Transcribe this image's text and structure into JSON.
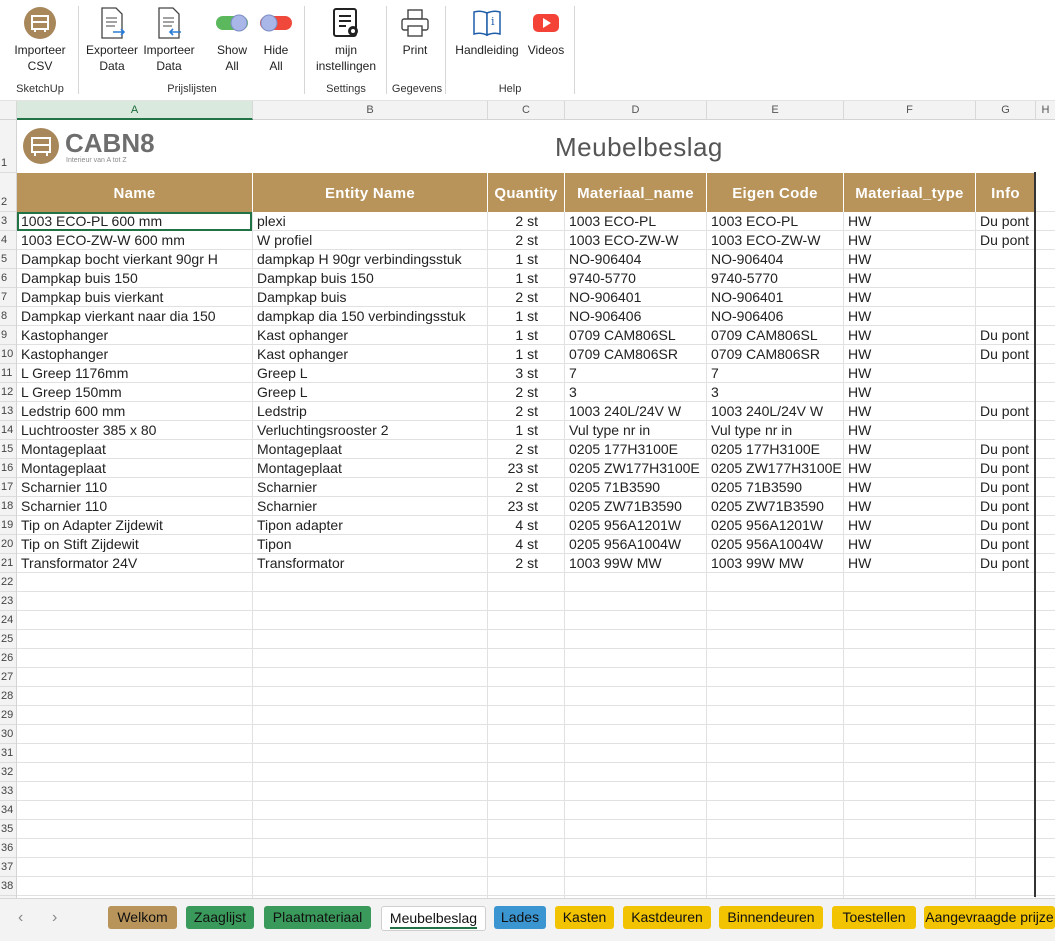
{
  "ribbon": {
    "buttons": [
      {
        "label": "Importeer\nCSV",
        "icon": "sketchup-logo-icon"
      },
      {
        "label": "Exporteer\nData",
        "icon": "export-document-icon"
      },
      {
        "label": "Importeer\nData",
        "icon": "import-document-icon"
      },
      {
        "label": "Show\nAll",
        "icon": "toggle-on-icon"
      },
      {
        "label": "Hide\nAll",
        "icon": "toggle-off-icon"
      },
      {
        "label": "mijn\ninstellingen",
        "icon": "settings-list-icon"
      },
      {
        "label": "Print",
        "icon": "printer-icon"
      },
      {
        "label": "Handleiding",
        "icon": "manual-book-icon"
      },
      {
        "label": "Videos",
        "icon": "youtube-play-icon"
      }
    ],
    "groups": [
      "SketchUp",
      "Prijslijsten",
      "Settings",
      "Gegevens",
      "Help"
    ]
  },
  "columns": [
    "A",
    "B",
    "C",
    "D",
    "E",
    "F",
    "G",
    "H"
  ],
  "logo": {
    "brand": "CABN8",
    "tagline": "Interieur van A tot Z"
  },
  "sheet_title": "Meubelbeslag",
  "table": {
    "headers": [
      "Name",
      "Entity Name",
      "Quantity",
      "Materiaal_name",
      "Eigen Code",
      "Materiaal_type",
      "Info"
    ],
    "rows": [
      [
        "1003 ECO-PL 600 mm",
        "plexi",
        "2 st",
        "1003 ECO-PL",
        "1003 ECO-PL",
        "HW",
        "Du pont"
      ],
      [
        "1003 ECO-ZW-W 600 mm",
        "W profiel",
        "2 st",
        "1003 ECO-ZW-W",
        "1003 ECO-ZW-W",
        "HW",
        "Du pont"
      ],
      [
        "Dampkap bocht vierkant 90gr H",
        "dampkap H 90gr verbindingsstuk",
        "1 st",
        "NO-906404",
        "NO-906404",
        "HW",
        ""
      ],
      [
        "Dampkap buis 150",
        "Dampkap buis 150",
        "1 st",
        "9740-5770",
        "9740-5770",
        "HW",
        ""
      ],
      [
        "Dampkap buis vierkant",
        "Dampkap buis",
        "2 st",
        "NO-906401",
        "NO-906401",
        "HW",
        ""
      ],
      [
        "Dampkap vierkant naar dia 150",
        "dampkap dia 150 verbindingsstuk",
        "1 st",
        "NO-906406",
        "NO-906406",
        "HW",
        ""
      ],
      [
        "Kastophanger",
        "Kast ophanger",
        "1 st",
        "0709 CAM806SL",
        "0709 CAM806SL",
        "HW",
        "Du pont"
      ],
      [
        "Kastophanger",
        "Kast ophanger",
        "1 st",
        "0709 CAM806SR",
        "0709 CAM806SR",
        "HW",
        "Du pont"
      ],
      [
        "L Greep 1176mm",
        "Greep L",
        "3 st",
        "7",
        "7",
        "HW",
        ""
      ],
      [
        "L Greep 150mm",
        "Greep L",
        "2 st",
        "3",
        "3",
        "HW",
        ""
      ],
      [
        "Ledstrip 600 mm",
        "Ledstrip",
        "2 st",
        "1003 240L/24V W",
        "1003 240L/24V W",
        "HW",
        "Du pont"
      ],
      [
        "Luchtrooster 385 x 80",
        "Verluchtingsrooster 2",
        "1 st",
        "Vul type nr in",
        "Vul type nr in",
        "HW",
        ""
      ],
      [
        "Montageplaat",
        "Montageplaat",
        "2 st",
        "0205 177H3100E",
        "0205 177H3100E",
        "HW",
        "Du pont"
      ],
      [
        "Montageplaat",
        "Montageplaat",
        "23 st",
        "0205 ZW177H3100E",
        "0205 ZW177H3100E",
        "HW",
        "Du pont"
      ],
      [
        "Scharnier 110",
        "Scharnier",
        "2 st",
        "0205 71B3590",
        "0205 71B3590",
        "HW",
        "Du pont"
      ],
      [
        "Scharnier 110",
        "Scharnier",
        "23 st",
        "0205 ZW71B3590",
        "0205 ZW71B3590",
        "HW",
        "Du pont"
      ],
      [
        "Tip on Adapter Zijdewit",
        "Tipon adapter",
        "4 st",
        "0205 956A1201W",
        "0205 956A1201W",
        "HW",
        "Du pont"
      ],
      [
        "Tip on Stift Zijdewit",
        "Tipon",
        "4 st",
        "0205 956A1004W",
        "0205 956A1004W",
        "HW",
        "Du pont"
      ],
      [
        "Transformator 24V",
        "Transformator",
        "2 st",
        "1003 99W MW",
        "1003 99W MW",
        "HW",
        "Du pont"
      ]
    ]
  },
  "row_numbers": [
    "1",
    "2",
    "3",
    "4",
    "5",
    "6",
    "7",
    "8",
    "9",
    "10",
    "11",
    "12",
    "13",
    "14",
    "15",
    "16",
    "17",
    "18",
    "19",
    "20",
    "21",
    "22",
    "23",
    "24",
    "25",
    "26",
    "27",
    "28",
    "29",
    "30",
    "31",
    "32",
    "33",
    "34",
    "35",
    "36",
    "37",
    "38"
  ],
  "tabs": [
    {
      "label": "Welkom",
      "color": "#b8935a"
    },
    {
      "label": "Zaaglijst",
      "color": "#3a9a5b"
    },
    {
      "label": "Plaatmateriaal",
      "color": "#3a9a5b"
    },
    {
      "label": "Meubelbeslag",
      "color": "#ffffff"
    },
    {
      "label": "Lades",
      "color": "#3a95d0"
    },
    {
      "label": "Kasten",
      "color": "#f2c300"
    },
    {
      "label": "Kastdeuren",
      "color": "#f2c300"
    },
    {
      "label": "Binnendeuren",
      "color": "#f2c300"
    },
    {
      "label": "Toestellen",
      "color": "#f2c300"
    },
    {
      "label": "Aangevraagde prijze",
      "color": "#f2c300"
    }
  ],
  "active_tab": "Meubelbeslag",
  "nav": {
    "prev": "‹",
    "next": "›"
  },
  "colors": {
    "header_fill": "#b8935a",
    "selection": "#217346"
  }
}
